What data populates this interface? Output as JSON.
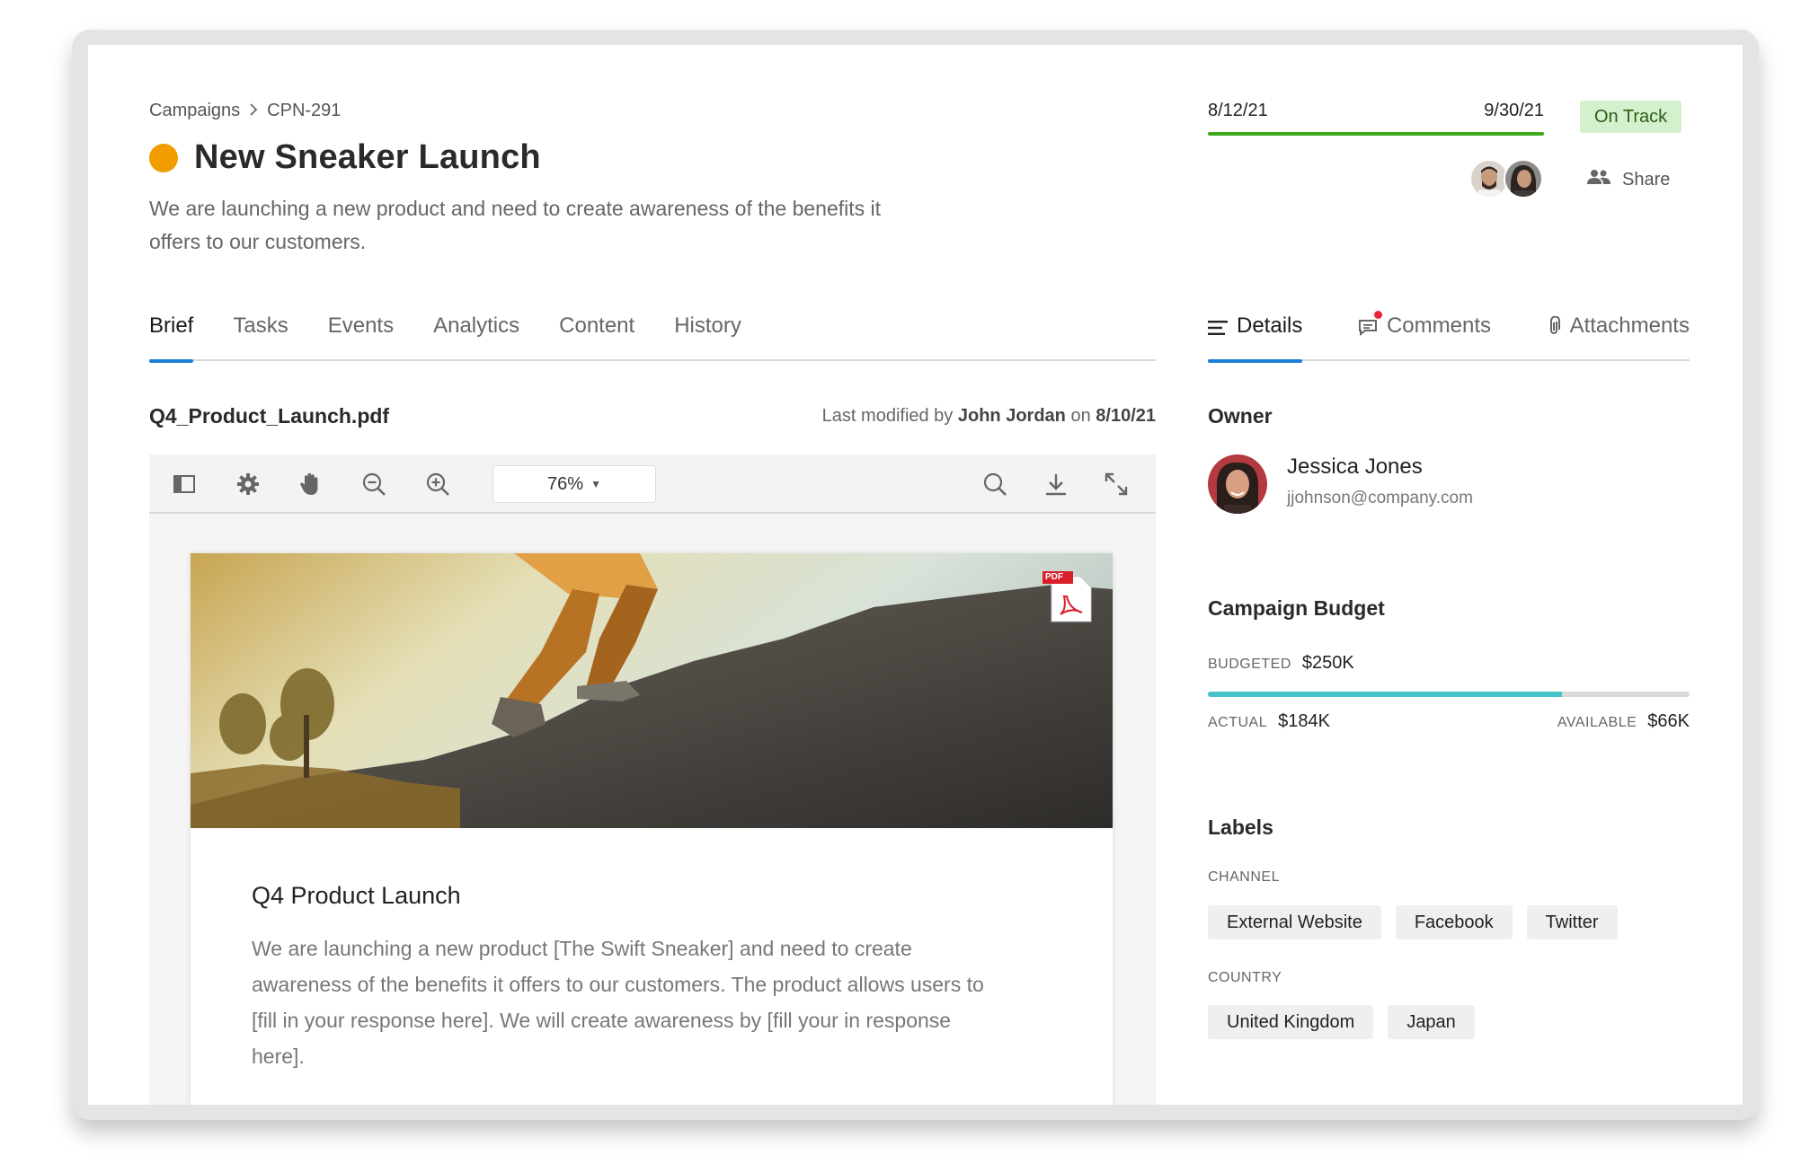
{
  "breadcrumb": {
    "items": [
      "Campaigns",
      "CPN-291"
    ],
    "separator": "›"
  },
  "campaign": {
    "title": "New Sneaker Launch",
    "status_color": "#f19d00",
    "description": "We are launching a new product and need to create awareness of the benefits it offers to our customers."
  },
  "timeline": {
    "start": "8/12/21",
    "end": "9/30/21",
    "status": "On Track",
    "status_color": "#d5f0cc",
    "bar_color": "#3daa1d"
  },
  "share": {
    "label": "Share"
  },
  "tabs": [
    {
      "label": "Brief",
      "active": true
    },
    {
      "label": "Tasks",
      "active": false
    },
    {
      "label": "Events",
      "active": false
    },
    {
      "label": "Analytics",
      "active": false
    },
    {
      "label": "Content",
      "active": false
    },
    {
      "label": "History",
      "active": false
    }
  ],
  "side_tabs": [
    {
      "label": "Details",
      "icon": "list-icon",
      "active": true
    },
    {
      "label": "Comments",
      "icon": "comment-icon",
      "active": false,
      "has_notification": true
    },
    {
      "label": "Attachments",
      "icon": "paperclip-icon",
      "active": false
    }
  ],
  "document": {
    "filename": "Q4_Product_Launch.pdf",
    "modified_prefix": "Last modified by",
    "modified_by": "John Jordan",
    "modified_on_label": "on",
    "modified_date": "8/10/21"
  },
  "viewer": {
    "zoom": "76%",
    "tools_left": [
      "sidebar-toggle-icon",
      "gear-icon",
      "hand-icon",
      "zoom-out-icon",
      "zoom-in-icon"
    ],
    "tools_right": [
      "search-icon",
      "download-icon",
      "expand-icon"
    ]
  },
  "pdf_page": {
    "badge": "PDF",
    "heading": "Q4 Product Launch",
    "body": "We are launching a new product [The Swift Sneaker] and need to create awareness of the benefits it offers to our customers. The product allows users to [fill in your response here]. We will create awareness by [fill your in response here]."
  },
  "owner": {
    "section_title": "Owner",
    "name": "Jessica Jones",
    "email": "jjohnson@company.com"
  },
  "budget": {
    "section_title": "Campaign Budget",
    "budgeted_label": "BUDGETED",
    "budgeted": "$250K",
    "actual_label": "ACTUAL",
    "actual": "$184K",
    "available_label": "AVAILABLE",
    "available": "$66K",
    "spent_fraction": 0.736,
    "bar_color": "#46c2c9"
  },
  "labels": {
    "section_title": "Labels",
    "channel_label": "CHANNEL",
    "channel": [
      "External Website",
      "Facebook",
      "Twitter"
    ],
    "country_label": "COUNTRY",
    "country": [
      "United Kingdom",
      "Japan"
    ]
  },
  "colors": {
    "accent": "#1a7fd8",
    "badge_text": "#2a5e17"
  }
}
